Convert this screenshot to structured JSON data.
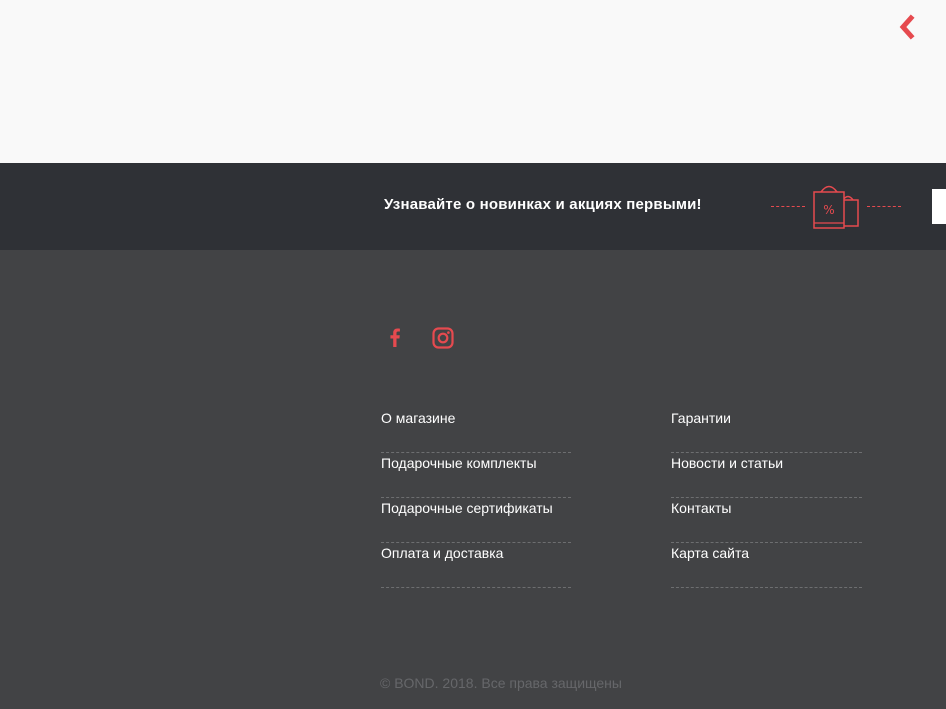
{
  "top": {
    "back_icon": "chevron-left-icon"
  },
  "newsletter": {
    "text": "Узнавайте о новинках и акциях первыми!",
    "icon": "shopping-bags-icon",
    "bag_badge": "%",
    "input_value": ""
  },
  "social": {
    "facebook_icon": "facebook-icon",
    "instagram_icon": "instagram-icon"
  },
  "menu": {
    "left": [
      {
        "label": "О магазине"
      },
      {
        "label": "Подарочные комплекты"
      },
      {
        "label": "Подарочные сертификаты"
      },
      {
        "label": "Оплата и доставка"
      }
    ],
    "right": [
      {
        "label": "Гарантии"
      },
      {
        "label": "Новости и статьи"
      },
      {
        "label": "Контакты"
      },
      {
        "label": "Карта сайта"
      }
    ]
  },
  "copyright": "© BOND. 2018. Все права защищены",
  "colors": {
    "accent": "#e64a4f",
    "band_bg": "#2f3136",
    "footer_bg": "#424345",
    "page_bg": "#f9f9f9"
  }
}
